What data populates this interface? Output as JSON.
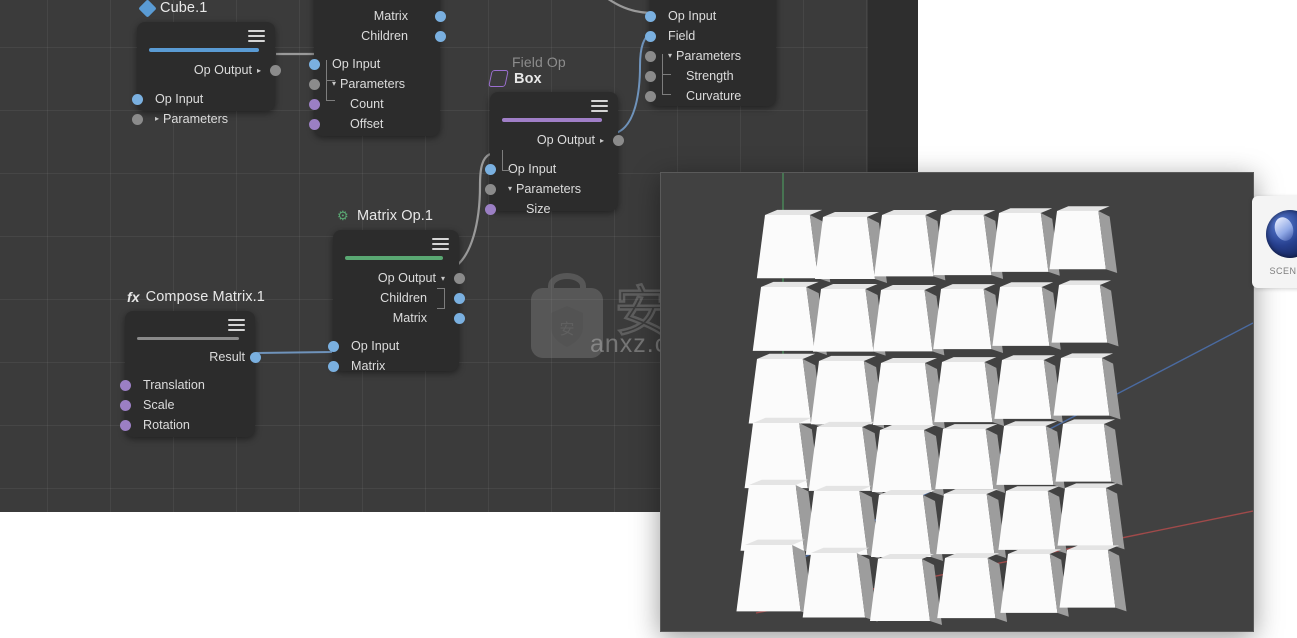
{
  "app": {
    "editor_background": "#3b3b3b",
    "node_background": "#2c2c2c",
    "viewport_background": "#414141"
  },
  "nodes": [
    {
      "id": "cube",
      "pretitle": "",
      "title": "Cube.1",
      "icon": "blue-diamond-icon",
      "accent_color": "#5a9bd4",
      "outputs": [
        {
          "label": "Op Output",
          "port": "gray",
          "arrow": "▸"
        }
      ],
      "inputs": [
        {
          "label": "Op Input",
          "port": "blue"
        },
        {
          "label": "Parameters",
          "port": "gray",
          "caret": "▸"
        }
      ]
    },
    {
      "id": "clone",
      "pretitle": "",
      "title": "",
      "icon": "",
      "accent_color": "",
      "outputs": [
        {
          "label": "Matrix",
          "port": "blue"
        },
        {
          "label": "Children",
          "port": "blue"
        }
      ],
      "inputs": [
        {
          "label": "Op Input",
          "port": "blue"
        },
        {
          "label": "Parameters",
          "port": "gray",
          "caret": "▾"
        },
        {
          "label": "Count",
          "port": "purple",
          "sub": true
        },
        {
          "label": "Offset",
          "port": "purple",
          "sub": true
        }
      ]
    },
    {
      "id": "box",
      "pretitle": "Field Op",
      "title": "Box",
      "icon": "purple-field-icon",
      "accent_color": "#a07fc8",
      "outputs": [
        {
          "label": "Op Output",
          "port": "gray",
          "arrow": "▸"
        }
      ],
      "inputs": [
        {
          "label": "Op Input",
          "port": "blue"
        },
        {
          "label": "Parameters",
          "port": "gray",
          "caret": "▾"
        },
        {
          "label": "Size",
          "port": "purple",
          "sub": true
        }
      ]
    },
    {
      "id": "fieldtarget",
      "pretitle": "",
      "title": "",
      "icon": "",
      "accent_color": "",
      "outputs": [],
      "inputs": [
        {
          "label": "Op Input",
          "port": "blue"
        },
        {
          "label": "Field",
          "port": "blue"
        },
        {
          "label": "Parameters",
          "port": "gray",
          "caret": "▾"
        },
        {
          "label": "Strength",
          "port": "gray",
          "sub": true
        },
        {
          "label": "Curvature",
          "port": "gray",
          "sub": true
        }
      ]
    },
    {
      "id": "matrixop",
      "pretitle": "",
      "title": "Matrix Op.1",
      "icon": "green-gear-icon",
      "accent_color": "#5aa873",
      "outputs": [
        {
          "label": "Op Output",
          "port": "gray",
          "arrow": "▾"
        },
        {
          "label": "Children",
          "port": "blue"
        },
        {
          "label": "Matrix",
          "port": "blue"
        }
      ],
      "inputs": [
        {
          "label": "Op Input",
          "port": "blue"
        },
        {
          "label": "Matrix",
          "port": "blue"
        }
      ]
    },
    {
      "id": "composematrix",
      "pretitle": "fx",
      "title": "Compose Matrix.1",
      "icon": "fx-icon",
      "accent_color": "#8a8a8a",
      "outputs": [
        {
          "label": "Result",
          "port": "blue"
        }
      ],
      "inputs": [
        {
          "label": "Translation",
          "port": "purple"
        },
        {
          "label": "Scale",
          "port": "purple"
        },
        {
          "label": "Rotation",
          "port": "purple"
        }
      ]
    }
  ],
  "watermark": {
    "text": "anxz.com",
    "logo_label": "安下载"
  },
  "app_icon": {
    "caption": "SCEN"
  },
  "viewport": {
    "axis_colors": {
      "x": "#a04a4a",
      "y": "#4a8a5a",
      "z": "#4a6aa0"
    },
    "object_count": 36,
    "grid_rows": 6,
    "grid_cols": 6
  }
}
